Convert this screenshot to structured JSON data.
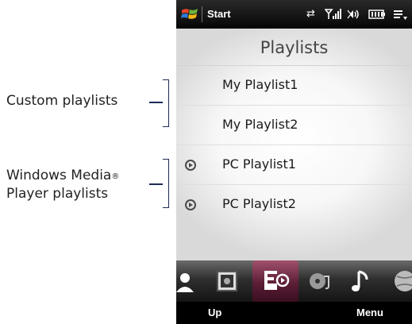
{
  "annotations": {
    "custom": "Custom playlists",
    "wmp_line1": "Windows Media",
    "wmp_reg": "®",
    "wmp_line2": "Player playlists"
  },
  "statusbar": {
    "start_label": "Start",
    "icons": [
      "windows-flag-icon",
      "data-connection-icon",
      "signal-strength-icon",
      "volume-icon",
      "battery-icon",
      "more-icon"
    ]
  },
  "screen": {
    "title": "Playlists",
    "playlists": [
      {
        "label": "My Playlist1",
        "kind": "custom"
      },
      {
        "label": "My Playlist2",
        "kind": "custom"
      },
      {
        "label": "PC Playlist1",
        "kind": "pc"
      },
      {
        "label": "PC Playlist2",
        "kind": "pc"
      }
    ]
  },
  "tabs": [
    {
      "name": "people-tab",
      "icon": "person-icon"
    },
    {
      "name": "photos-tab",
      "icon": "photo-icon"
    },
    {
      "name": "music-tab",
      "icon": "playlist-icon",
      "selected": true
    },
    {
      "name": "albums-tab",
      "icon": "albums-icon"
    },
    {
      "name": "music-note-tab",
      "icon": "music-note-icon"
    },
    {
      "name": "internet-tab",
      "icon": "globe-icon"
    }
  ],
  "softkeys": {
    "left": "Up",
    "right": "Menu"
  },
  "colors": {
    "selected_tab": "#7a2d4c",
    "bracket": "#1f2a55"
  }
}
